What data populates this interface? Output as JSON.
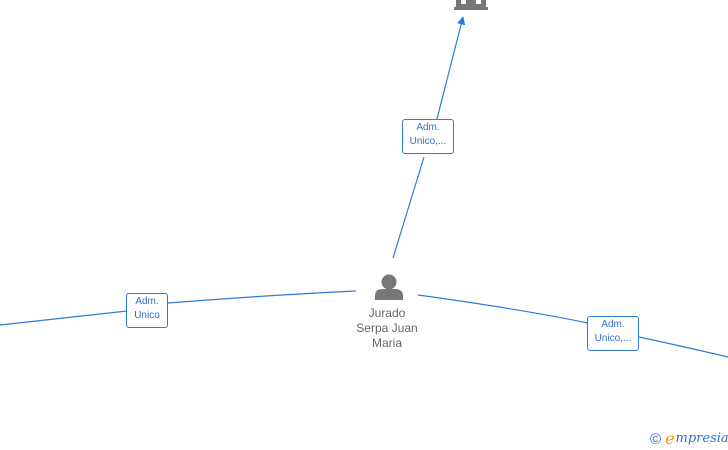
{
  "person": {
    "name_lines": [
      "Jurado",
      "Serpa Juan",
      "Maria"
    ],
    "icon": "person-icon"
  },
  "company": {
    "icon": "building-icon"
  },
  "edges": [
    {
      "id": "top",
      "label_lines": [
        "Adm.",
        "Unico,..."
      ]
    },
    {
      "id": "left",
      "label_lines": [
        "Adm.",
        "Unico"
      ]
    },
    {
      "id": "right",
      "label_lines": [
        "Adm.",
        "Unico,..."
      ]
    }
  ],
  "watermark": {
    "symbol": "©",
    "brand_initial": "e",
    "brand_rest": "mpresia"
  },
  "colors": {
    "edge": "#2f7bd8",
    "node_icon": "#777777",
    "brand_orange": "#f29400"
  }
}
